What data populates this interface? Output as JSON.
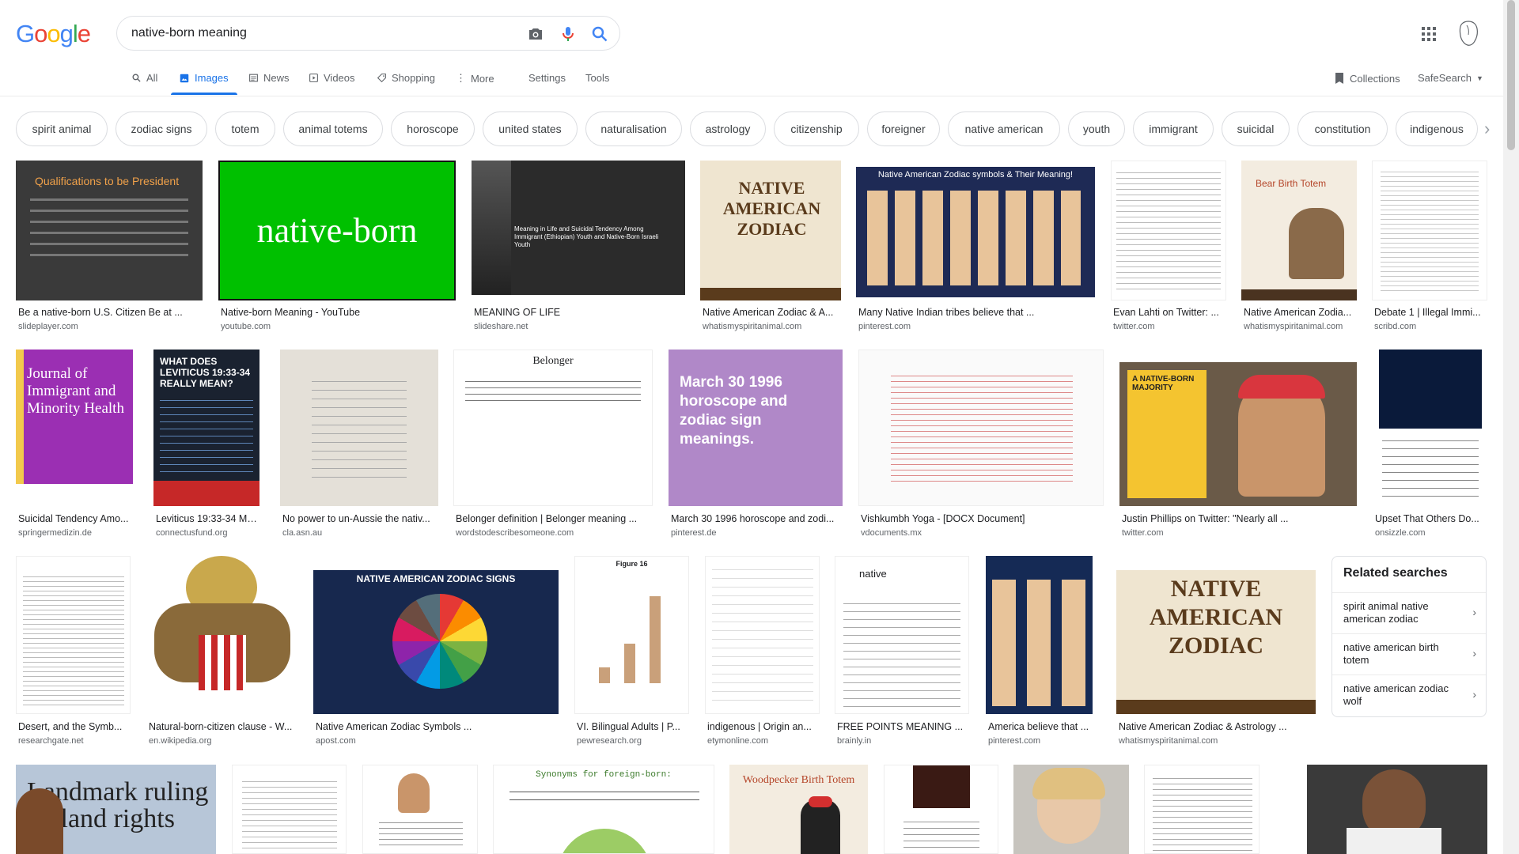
{
  "header": {
    "logo_letters": [
      "G",
      "o",
      "o",
      "g",
      "l",
      "e"
    ],
    "logo_colors": [
      "#4285f4",
      "#ea4335",
      "#fbbc05",
      "#4285f4",
      "#34a853",
      "#ea4335"
    ],
    "query": "native-born meaning"
  },
  "tabs": {
    "all": "All",
    "images": "Images",
    "news": "News",
    "videos": "Videos",
    "shopping": "Shopping",
    "more": "More",
    "settings": "Settings",
    "tools": "Tools",
    "collections": "Collections",
    "safesearch": "SafeSearch"
  },
  "chips": [
    "spirit animal",
    "zodiac signs",
    "totem",
    "animal totems",
    "horoscope",
    "united states",
    "naturalisation",
    "astrology",
    "citizenship",
    "foreigner",
    "native american",
    "youth",
    "immigrant",
    "suicidal",
    "constitution",
    "indigenous"
  ],
  "results": [
    {
      "caption": "Be a native-born U.S. Citizen  Be at ...",
      "source": "slideplayer.com",
      "text": "Qualifications to be President"
    },
    {
      "caption": "Native-born Meaning - YouTube",
      "source": "youtube.com",
      "text": "native-born"
    },
    {
      "caption": "MEANING OF LIFE",
      "source": "slideshare.net",
      "text": "Meaning in Life and Suicidal Tendency Among Immigrant (Ethiopian) Youth and Native-Born Israeli Youth"
    },
    {
      "caption": "Native American Zodiac & A...",
      "source": "whatismyspiritanimal.com",
      "text": "NATIVE AMERICAN ZODIAC"
    },
    {
      "caption": "Many Native Indian tribes believe that ...",
      "source": "pinterest.com",
      "text": "Native American Zodiac symbols & Their Meaning!"
    },
    {
      "caption": "Evan Lahti on Twitter: ...",
      "source": "twitter.com",
      "text": ""
    },
    {
      "caption": "Native American Zodia...",
      "source": "whatismyspiritanimal.com",
      "text": "Bear Birth Totem"
    },
    {
      "caption": "Debate 1 | Illegal Immi...",
      "source": "scribd.com",
      "text": ""
    },
    {
      "caption": "Suicidal Tendency Amo...",
      "source": "springermedizin.de",
      "text": "Journal of Immigrant and Minority Health"
    },
    {
      "caption": "Leviticus 19:33-34 Me...",
      "source": "connectusfund.org",
      "text": "WHAT DOES LEVITICUS 19:33-34 REALLY MEAN?"
    },
    {
      "caption": "No power to un-Aussie the nativ...",
      "source": "cla.asn.au",
      "text": ""
    },
    {
      "caption": "Belonger definition | Belonger meaning ...",
      "source": "wordstodescribesomeone.com",
      "text": "Belonger"
    },
    {
      "caption": "March 30 1996 horoscope and zodi...",
      "source": "pinterest.de",
      "text": "March 30 1996 horoscope and zodiac sign meanings."
    },
    {
      "caption": "Vishkumbh Yoga - [DOCX Document]",
      "source": "vdocuments.mx",
      "text": ""
    },
    {
      "caption": "Justin Phillips on Twitter: \"Nearly all ...",
      "source": "twitter.com",
      "text": "A NATIVE-BORN MAJORITY"
    },
    {
      "caption": "Upset That Others Do...",
      "source": "onsizzle.com",
      "text": ""
    },
    {
      "caption": "Desert, and the Symb...",
      "source": "researchgate.net",
      "text": ""
    },
    {
      "caption": "Natural-born-citizen clause - W...",
      "source": "en.wikipedia.org",
      "text": ""
    },
    {
      "caption": "Native American Zodiac Symbols ...",
      "source": "apost.com",
      "text": "NATIVE AMERICAN ZODIAC SIGNS"
    },
    {
      "caption": "VI. Bilingual Adults | P...",
      "source": "pewresearch.org",
      "text": "Figure 16"
    },
    {
      "caption": "indigenous | Origin an...",
      "source": "etymonline.com",
      "text": ""
    },
    {
      "caption": "FREE POINTS MEANING ...",
      "source": "brainly.in",
      "text": "native"
    },
    {
      "caption": "America believe that ...",
      "source": "pinterest.com",
      "text": ""
    },
    {
      "caption": "Native American Zodiac & Astrology ...",
      "source": "whatismyspiritanimal.com",
      "text": "NATIVE AMERICAN ZODIAC"
    },
    {
      "caption": "",
      "source": "",
      "text": "Landmark ruling on land rights"
    },
    {
      "caption": "",
      "source": "",
      "text": ""
    },
    {
      "caption": "",
      "source": "",
      "text": ""
    },
    {
      "caption": "",
      "source": "",
      "text": "Synonyms for foreign-born:"
    },
    {
      "caption": "",
      "source": "",
      "text": "Woodpecker Birth Totem"
    },
    {
      "caption": "",
      "source": "",
      "text": ""
    },
    {
      "caption": "",
      "source": "",
      "text": ""
    },
    {
      "caption": "",
      "source": "",
      "text": ""
    },
    {
      "caption": "",
      "source": "",
      "text": ""
    }
  ],
  "related": {
    "title": "Related searches",
    "items": [
      "spirit animal native american zodiac",
      "native american birth totem",
      "native american zodiac wolf"
    ]
  },
  "colors": {
    "accent": "#1a73e8",
    "chip_border": "#dadce0"
  }
}
